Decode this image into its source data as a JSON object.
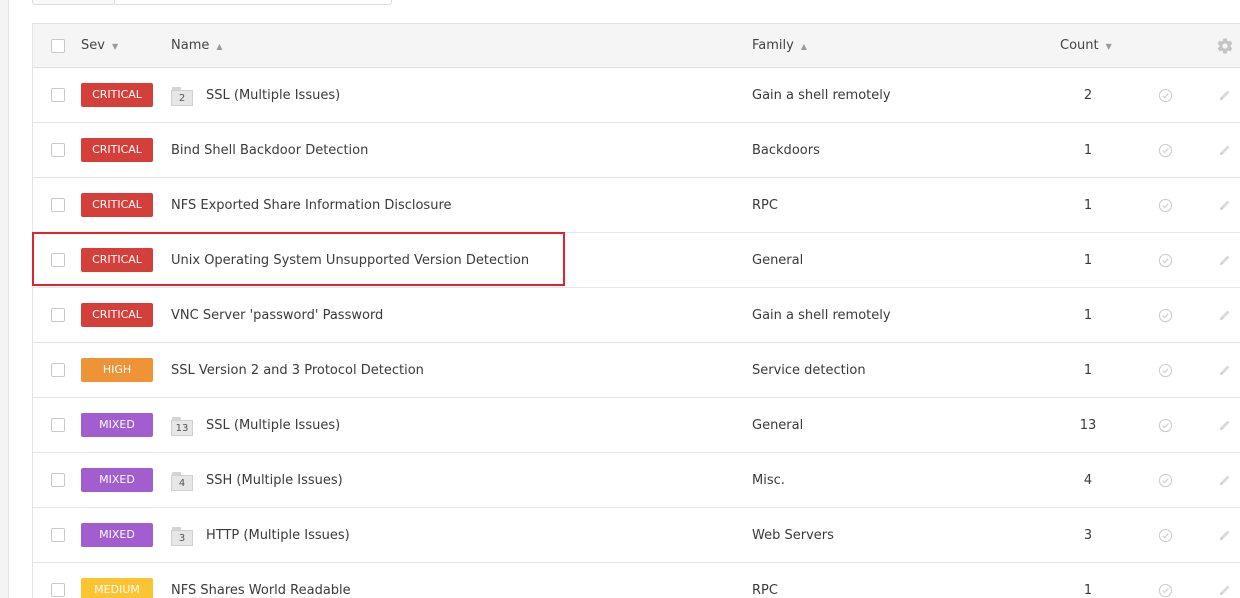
{
  "colors": {
    "critical": "#d43f3a",
    "high": "#ee9336",
    "mixed": "#a25ece",
    "medium": "#fdc431",
    "highlight": "#e2232b"
  },
  "header": {
    "sev": "Sev",
    "name": "Name",
    "family": "Family",
    "count": "Count",
    "sort_desc": "▼",
    "sort_asc": "▲",
    "settings_icon": "gear-icon"
  },
  "rows": [
    {
      "severity": "CRITICAL",
      "sev_color": "#d43f3a",
      "folder_count": "2",
      "name": "SSL (Multiple Issues)",
      "family": "Gain a shell remotely",
      "count": "2"
    },
    {
      "severity": "CRITICAL",
      "sev_color": "#d43f3a",
      "folder_count": "",
      "name": "Bind Shell Backdoor Detection",
      "family": "Backdoors",
      "count": "1"
    },
    {
      "severity": "CRITICAL",
      "sev_color": "#d43f3a",
      "folder_count": "",
      "name": "NFS Exported Share Information Disclosure",
      "family": "RPC",
      "count": "1"
    },
    {
      "severity": "CRITICAL",
      "sev_color": "#d43f3a",
      "folder_count": "",
      "name": "Unix Operating System Unsupported Version Detection",
      "family": "General",
      "count": "1"
    },
    {
      "severity": "CRITICAL",
      "sev_color": "#d43f3a",
      "folder_count": "",
      "name": "VNC Server 'password' Password",
      "family": "Gain a shell remotely",
      "count": "1"
    },
    {
      "severity": "HIGH",
      "sev_color": "#ee9336",
      "folder_count": "",
      "name": "SSL Version 2 and 3 Protocol Detection",
      "family": "Service detection",
      "count": "1"
    },
    {
      "severity": "MIXED",
      "sev_color": "#a25ece",
      "folder_count": "13",
      "name": "SSL (Multiple Issues)",
      "family": "General",
      "count": "13"
    },
    {
      "severity": "MIXED",
      "sev_color": "#a25ece",
      "folder_count": "4",
      "name": "SSH (Multiple Issues)",
      "family": "Misc.",
      "count": "4"
    },
    {
      "severity": "MIXED",
      "sev_color": "#a25ece",
      "folder_count": "3",
      "name": "HTTP (Multiple Issues)",
      "family": "Web Servers",
      "count": "3"
    },
    {
      "severity": "MEDIUM",
      "sev_color": "#fdc431",
      "folder_count": "",
      "name": "NFS Shares World Readable",
      "family": "RPC",
      "count": "1"
    }
  ]
}
